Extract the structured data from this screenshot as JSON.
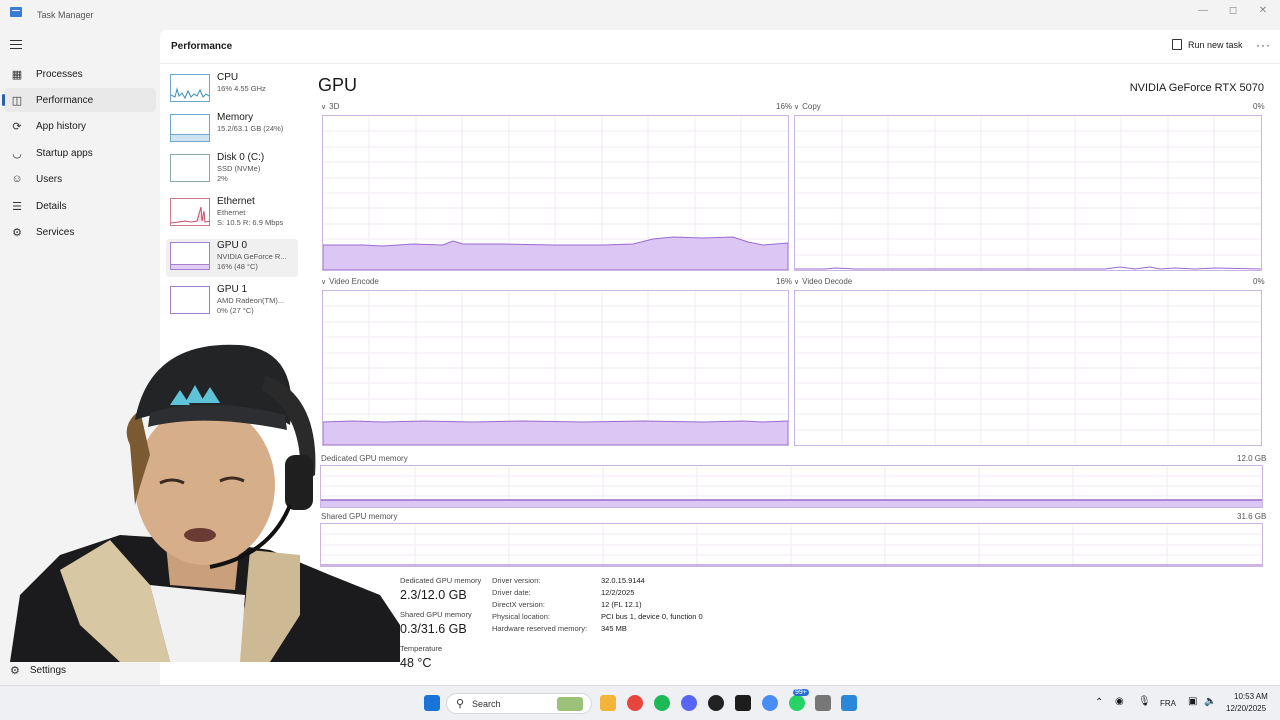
{
  "window": {
    "title": "Task Manager"
  },
  "nav": {
    "items": [
      {
        "label": "Processes",
        "icon": "grid-icon"
      },
      {
        "label": "Performance",
        "icon": "performance-icon"
      },
      {
        "label": "App history",
        "icon": "history-icon"
      },
      {
        "label": "Startup apps",
        "icon": "speedometer-icon"
      },
      {
        "label": "Users",
        "icon": "users-icon"
      },
      {
        "label": "Details",
        "icon": "list-icon"
      },
      {
        "label": "Services",
        "icon": "gear-icon"
      }
    ],
    "settings": "Settings"
  },
  "header": {
    "title": "Performance",
    "run_task": "Run new task"
  },
  "perf_list": [
    {
      "name": "CPU",
      "line1": "16% 4.55 GHz",
      "line2": ""
    },
    {
      "name": "Memory",
      "line1": "15.2/63.1 GB (24%)",
      "line2": ""
    },
    {
      "name": "Disk 0 (C:)",
      "line1": "SSD (NVMe)",
      "line2": "2%"
    },
    {
      "name": "Ethernet",
      "line1": "Ethernet",
      "line2": "S: 10.5 R: 6.9 Mbps"
    },
    {
      "name": "GPU 0",
      "line1": "NVIDIA GeForce R...",
      "line2": "16% (48 °C)"
    },
    {
      "name": "GPU 1",
      "line1": "AMD Radeon(TM)...",
      "line2": "0% (27 °C)"
    }
  ],
  "gpu": {
    "title": "GPU",
    "name": "NVIDIA GeForce RTX 5070",
    "engines": [
      {
        "label": "3D",
        "value": "16%",
        "level": 0.16
      },
      {
        "label": "Copy",
        "value": "0%",
        "level": 0.0
      },
      {
        "label": "Video Encode",
        "value": "16%",
        "level": 0.16
      },
      {
        "label": "Video Decode",
        "value": "0%",
        "level": 0.0
      }
    ],
    "dedicated": {
      "label": "Dedicated GPU memory",
      "max": "12.0 GB",
      "level": 0.19
    },
    "shared": {
      "label": "Shared GPU memory",
      "max": "31.6 GB",
      "level": 0.01
    },
    "stats": {
      "dedicated_label": "Dedicated GPU memory",
      "dedicated_value": "2.3/12.0 GB",
      "shared_label": "Shared GPU memory",
      "shared_value": "0.3/31.6 GB",
      "temp_label": "Temperature",
      "temp_value": "48 °C"
    },
    "details": [
      {
        "key": "Driver version:",
        "value": "32.0.15.9144"
      },
      {
        "key": "Driver date:",
        "value": "12/2/2025"
      },
      {
        "key": "DirectX version:",
        "value": "12 (FL 12.1)"
      },
      {
        "key": "Physical location:",
        "value": "PCI bus 1, device 0, function 0"
      },
      {
        "key": "Hardware reserved memory:",
        "value": "345 MB"
      }
    ]
  },
  "taskbar": {
    "search": "Search",
    "language": "FRA",
    "time": "10:53 AM",
    "date": "12/20/2025",
    "badge": "99+"
  }
}
